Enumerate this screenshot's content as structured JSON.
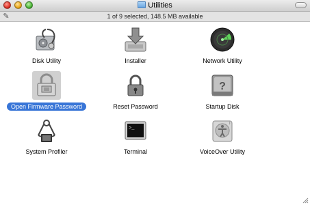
{
  "window": {
    "title": "Utilities",
    "status_text": "1 of 9 selected, 148.5 MB available"
  },
  "items": [
    {
      "label": "Disk Utility",
      "icon": "disk-utility-icon",
      "selected": false
    },
    {
      "label": "Installer",
      "icon": "installer-icon",
      "selected": false
    },
    {
      "label": "Network Utility",
      "icon": "network-utility-icon",
      "selected": false
    },
    {
      "label": "Open Firmware Password",
      "icon": "open-firmware-password-icon",
      "selected": true
    },
    {
      "label": "Reset Password",
      "icon": "reset-password-icon",
      "selected": false
    },
    {
      "label": "Startup Disk",
      "icon": "startup-disk-icon",
      "selected": false
    },
    {
      "label": "System Profiler",
      "icon": "system-profiler-icon",
      "selected": false
    },
    {
      "label": "Terminal",
      "icon": "terminal-icon",
      "selected": false
    },
    {
      "label": "VoiceOver Utility",
      "icon": "voiceover-utility-icon",
      "selected": false
    }
  ],
  "colors": {
    "selection": "#3875d7"
  }
}
